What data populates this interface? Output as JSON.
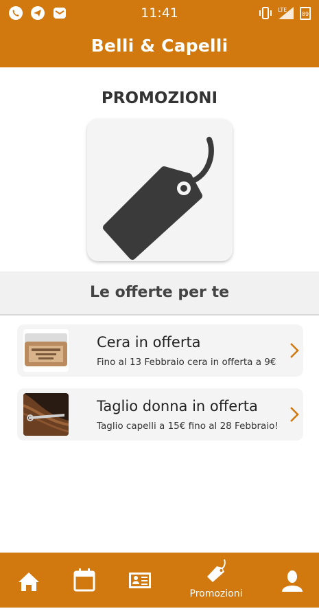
{
  "status_bar": {
    "time": "11:41",
    "battery": "89",
    "network": "LTE"
  },
  "app_bar": {
    "title": "Belli & Capelli"
  },
  "main": {
    "title": "PROMOZIONI",
    "hero_icon": "price-tag-icon",
    "section_header": "Le offerte per te",
    "offers": [
      {
        "title": "Cera in offerta",
        "description": "Fino al 13 Febbraio cera in offerta a 9€",
        "image": "wax-jar-thumbnail"
      },
      {
        "title": "Taglio donna in offerta",
        "description": "Taglio capelli a 15€ fino al 28 Febbraio!",
        "image": "haircut-thumbnail"
      }
    ]
  },
  "bottom_nav": {
    "items": [
      {
        "icon": "home-icon",
        "label": ""
      },
      {
        "icon": "calendar-icon",
        "label": ""
      },
      {
        "icon": "contact-card-icon",
        "label": ""
      },
      {
        "icon": "price-tag-icon",
        "label": "Promozioni",
        "active": true
      },
      {
        "icon": "person-icon",
        "label": ""
      }
    ]
  },
  "colors": {
    "accent": "#d1780e",
    "card": "#f4f4f4",
    "text": "#333333"
  }
}
